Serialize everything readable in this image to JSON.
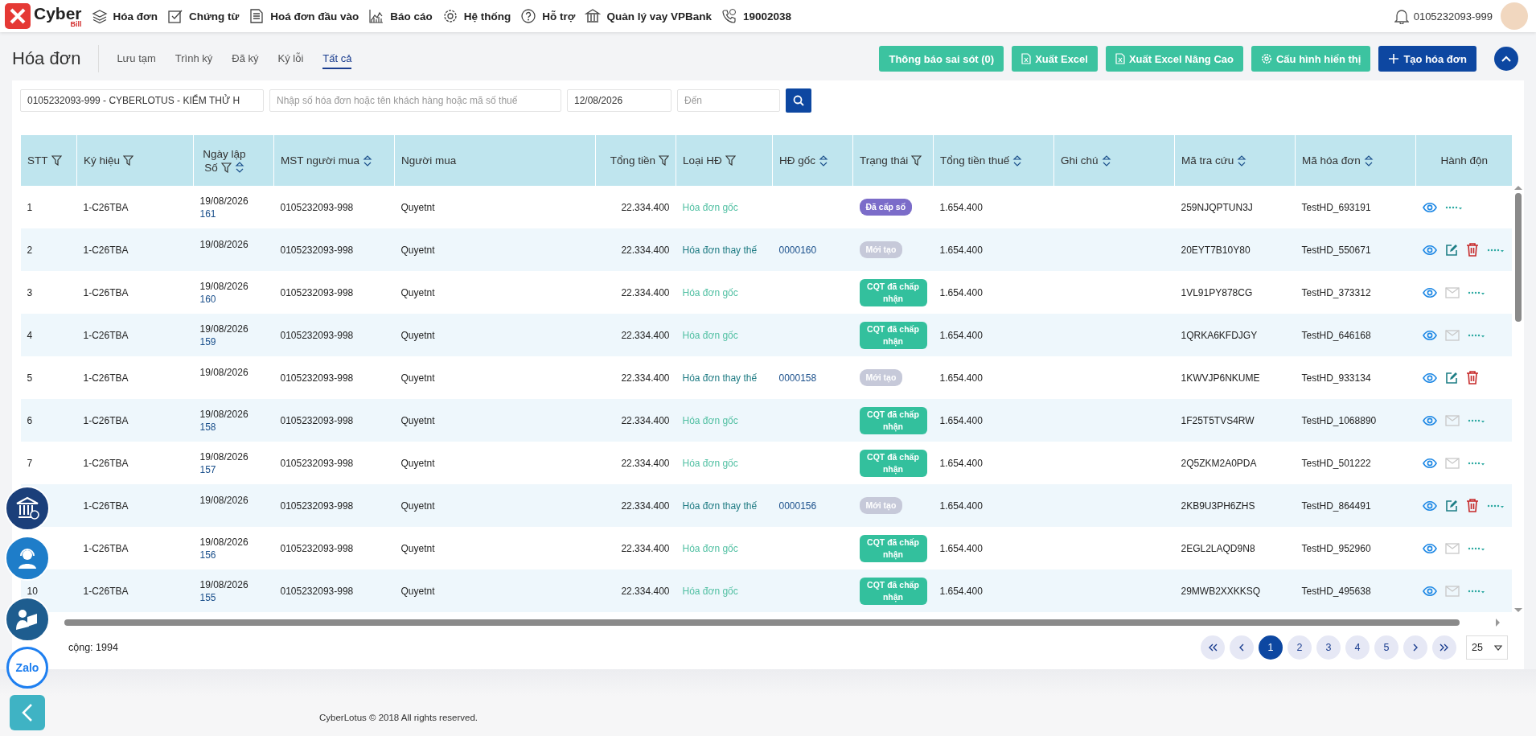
{
  "logo": {
    "name": "Cyber",
    "sub": "Bill"
  },
  "nav": {
    "items": [
      {
        "label": "Hóa đơn"
      },
      {
        "label": "Chứng từ"
      },
      {
        "label": "Hoá đơn đầu vào"
      },
      {
        "label": "Báo cáo"
      },
      {
        "label": "Hệ thống"
      },
      {
        "label": "Hỗ trợ"
      },
      {
        "label": "Quản lý vay VPBank"
      },
      {
        "label": "19002038"
      }
    ]
  },
  "user": {
    "account": "0105232093-999"
  },
  "page": {
    "title": "Hóa đơn"
  },
  "tabs": [
    {
      "label": "Lưu tạm",
      "selected": false
    },
    {
      "label": "Trình ký",
      "selected": false
    },
    {
      "label": "Đã ký",
      "selected": false
    },
    {
      "label": "Ký lỗi",
      "selected": false
    },
    {
      "label": "Tất cả",
      "selected": true
    }
  ],
  "actions": [
    {
      "label": "Thông báo sai sót (0)",
      "kind": "plain"
    },
    {
      "label": "Xuất Excel",
      "kind": "excel"
    },
    {
      "label": "Xuất Excel Nâng Cao",
      "kind": "excel"
    },
    {
      "label": "Cấu hình hiển thị",
      "kind": "settings"
    },
    {
      "label": "Tạo hóa đơn",
      "kind": "create"
    }
  ],
  "filters": {
    "company": "0105232093-999 - CYBERLOTUS - KIỂM THỬ H",
    "search_placeholder": "Nhập số hóa đơn hoặc tên khách hàng hoặc mã số thuế",
    "date_from": "12/08/2026",
    "date_to_placeholder": "Đến"
  },
  "table": {
    "columns": [
      {
        "label": "STT",
        "filter": true,
        "sort": false
      },
      {
        "label": "Ký hiệu",
        "filter": true,
        "sort": false
      },
      {
        "label": "Ngày lập",
        "sub_label": "Số",
        "filter": true,
        "sort": true
      },
      {
        "label": "MST người mua",
        "filter": false,
        "sort": true
      },
      {
        "label": "Người mua",
        "filter": false,
        "sort": false
      },
      {
        "label": "Tổng tiền",
        "filter": true,
        "sort": false
      },
      {
        "label": "Loại HĐ",
        "filter": true,
        "sort": false
      },
      {
        "label": "HĐ gốc",
        "filter": false,
        "sort": true
      },
      {
        "label": "Trạng thái",
        "filter": true,
        "sort": false
      },
      {
        "label": "Tổng tiền thuế",
        "filter": false,
        "sort": true
      },
      {
        "label": "Ghi chú",
        "filter": false,
        "sort": true
      },
      {
        "label": "Mã tra cứu",
        "filter": false,
        "sort": true
      },
      {
        "label": "Mã hóa đơn",
        "filter": false,
        "sort": true
      },
      {
        "label": "Hành độn",
        "filter": false,
        "sort": false
      }
    ],
    "rows": [
      {
        "stt": "1",
        "symbol": "1-C26TBA",
        "date": "19/08/2026",
        "number": "161",
        "buyer_tax_id": "0105232093-998",
        "buyer": "Quyetnt",
        "total": "22.334.400",
        "type": {
          "label": "Hóa đơn gốc",
          "kind": "original"
        },
        "status": {
          "label": "Đã cấp số",
          "kind": "issued"
        },
        "tax_total": "1.654.400",
        "lookup_code": "259NJQPTUN3J",
        "invoice_code": "TestHD_693191",
        "actions": [
          {
            "kind": "view"
          },
          {
            "kind": "more"
          }
        ]
      },
      {
        "stt": "2",
        "symbol": "1-C26TBA",
        "date": "19/08/2026",
        "buyer_tax_id": "0105232093-998",
        "buyer": "Quyetnt",
        "total": "22.334.400",
        "type": {
          "label": "Hóa đơn thay thế",
          "kind": "replacement"
        },
        "original_ref": "0000160",
        "status": {
          "label": "Mới tạo",
          "kind": "new"
        },
        "tax_total": "1.654.400",
        "lookup_code": "20EYT7B10Y80",
        "invoice_code": "TestHD_550671",
        "actions": [
          {
            "kind": "view"
          },
          {
            "kind": "edit"
          },
          {
            "kind": "delete"
          },
          {
            "kind": "more"
          }
        ]
      },
      {
        "stt": "3",
        "symbol": "1-C26TBA",
        "date": "19/08/2026",
        "number": "160",
        "buyer_tax_id": "0105232093-998",
        "buyer": "Quyetnt",
        "total": "22.334.400",
        "type": {
          "label": "Hóa đơn gốc",
          "kind": "original"
        },
        "status": {
          "label": "CQT đã chấp nhận",
          "kind": "accepted"
        },
        "tax_total": "1.654.400",
        "lookup_code": "1VL91PY878CG",
        "invoice_code": "TestHD_373312",
        "actions": [
          {
            "kind": "view"
          },
          {
            "kind": "mail"
          },
          {
            "kind": "more"
          }
        ]
      },
      {
        "stt": "4",
        "symbol": "1-C26TBA",
        "date": "19/08/2026",
        "number": "159",
        "buyer_tax_id": "0105232093-998",
        "buyer": "Quyetnt",
        "total": "22.334.400",
        "type": {
          "label": "Hóa đơn gốc",
          "kind": "original"
        },
        "status": {
          "label": "CQT đã chấp nhận",
          "kind": "accepted"
        },
        "tax_total": "1.654.400",
        "lookup_code": "1QRKA6KFDJGY",
        "invoice_code": "TestHD_646168",
        "actions": [
          {
            "kind": "view"
          },
          {
            "kind": "mail"
          },
          {
            "kind": "more"
          }
        ]
      },
      {
        "stt": "5",
        "symbol": "1-C26TBA",
        "date": "19/08/2026",
        "buyer_tax_id": "0105232093-998",
        "buyer": "Quyetnt",
        "total": "22.334.400",
        "type": {
          "label": "Hóa đơn thay thế",
          "kind": "replacement"
        },
        "original_ref": "0000158",
        "status": {
          "label": "Mới tạo",
          "kind": "new"
        },
        "tax_total": "1.654.400",
        "lookup_code": "1KWVJP6NKUME",
        "invoice_code": "TestHD_933134",
        "actions": [
          {
            "kind": "view"
          },
          {
            "kind": "edit"
          },
          {
            "kind": "delete"
          }
        ]
      },
      {
        "stt": "6",
        "symbol": "1-C26TBA",
        "date": "19/08/2026",
        "number": "158",
        "buyer_tax_id": "0105232093-998",
        "buyer": "Quyetnt",
        "total": "22.334.400",
        "type": {
          "label": "Hóa đơn gốc",
          "kind": "original"
        },
        "status": {
          "label": "CQT đã chấp nhận",
          "kind": "accepted"
        },
        "tax_total": "1.654.400",
        "lookup_code": "1F25T5TVS4RW",
        "invoice_code": "TestHD_1068890",
        "actions": [
          {
            "kind": "view"
          },
          {
            "kind": "mail"
          },
          {
            "kind": "more"
          }
        ]
      },
      {
        "stt": "7",
        "symbol": "1-C26TBA",
        "date": "19/08/2026",
        "number": "157",
        "buyer_tax_id": "0105232093-998",
        "buyer": "Quyetnt",
        "total": "22.334.400",
        "type": {
          "label": "Hóa đơn gốc",
          "kind": "original"
        },
        "status": {
          "label": "CQT đã chấp nhận",
          "kind": "accepted"
        },
        "tax_total": "1.654.400",
        "lookup_code": "2Q5ZKM2A0PDA",
        "invoice_code": "TestHD_501222",
        "actions": [
          {
            "kind": "view"
          },
          {
            "kind": "mail"
          },
          {
            "kind": "more"
          }
        ]
      },
      {
        "symbol": "1-C26TBA",
        "date": "19/08/2026",
        "buyer_tax_id": "0105232093-998",
        "buyer": "Quyetnt",
        "total": "22.334.400",
        "type": {
          "label": "Hóa đơn thay thế",
          "kind": "replacement"
        },
        "original_ref": "0000156",
        "status": {
          "label": "Mới tạo",
          "kind": "new"
        },
        "tax_total": "1.654.400",
        "lookup_code": "2KB9U3PH6ZHS",
        "invoice_code": "TestHD_864491",
        "actions": [
          {
            "kind": "view"
          },
          {
            "kind": "edit"
          },
          {
            "kind": "delete"
          },
          {
            "kind": "more"
          }
        ]
      },
      {
        "symbol": "1-C26TBA",
        "date": "19/08/2026",
        "number": "156",
        "buyer_tax_id": "0105232093-998",
        "buyer": "Quyetnt",
        "total": "22.334.400",
        "type": {
          "label": "Hóa đơn gốc",
          "kind": "original"
        },
        "status": {
          "label": "CQT đã chấp nhận",
          "kind": "accepted"
        },
        "tax_total": "1.654.400",
        "lookup_code": "2EGL2LAQD9N8",
        "invoice_code": "TestHD_952960",
        "actions": [
          {
            "kind": "view"
          },
          {
            "kind": "mail"
          },
          {
            "kind": "more"
          }
        ]
      },
      {
        "stt": "10",
        "symbol": "1-C26TBA",
        "date": "19/08/2026",
        "number": "155",
        "buyer_tax_id": "0105232093-998",
        "buyer": "Quyetnt",
        "total": "22.334.400",
        "type": {
          "label": "Hóa đơn gốc",
          "kind": "original"
        },
        "status": {
          "label": "CQT đã chấp nhận",
          "kind": "accepted"
        },
        "tax_total": "1.654.400",
        "lookup_code": "29MWB2XXKKSQ",
        "invoice_code": "TestHD_495638",
        "actions": [
          {
            "kind": "view"
          },
          {
            "kind": "mail"
          },
          {
            "kind": "more"
          }
        ]
      }
    ]
  },
  "summary": {
    "total": "cộng: 1994"
  },
  "pagination": {
    "pages": [
      {
        "label": "1",
        "selected": true
      },
      {
        "label": "2",
        "selected": false
      },
      {
        "label": "3",
        "selected": false
      },
      {
        "label": "4",
        "selected": false
      },
      {
        "label": "5",
        "selected": false
      }
    ],
    "page_size": "25"
  },
  "floating": {
    "zalo": "Zalo"
  },
  "footer": "CyberLotus © 2018 All rights reserved."
}
